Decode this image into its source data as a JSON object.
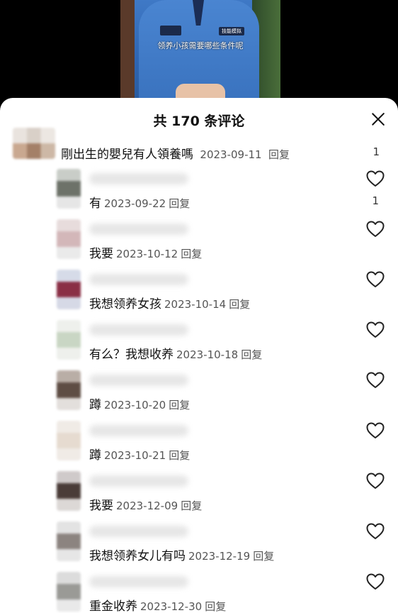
{
  "video": {
    "caption": "领养小孩需要哪些条件呢",
    "patch_text": "技能模拟"
  },
  "comments_panel": {
    "title": "共 170 条评论",
    "close_icon": "close-icon",
    "reply_label": "回复"
  },
  "parent_comment": {
    "text": "剛出生的嬰兒有人領養嗎",
    "date": "2023-09-11",
    "reply_label": "回复",
    "count": "1"
  },
  "replies": [
    {
      "text": "有",
      "date": "2023-09-22",
      "reply_label": "回复",
      "likes": "1"
    },
    {
      "text": "我要",
      "date": "2023-10-12",
      "reply_label": "回复",
      "likes": ""
    },
    {
      "text": "我想领养女孩",
      "date": "2023-10-14",
      "reply_label": "回复",
      "likes": ""
    },
    {
      "text": "有么？我想收养",
      "date": "2023-10-18",
      "reply_label": "回复",
      "likes": ""
    },
    {
      "text": "蹲",
      "date": "2023-10-20",
      "reply_label": "回复",
      "likes": ""
    },
    {
      "text": "蹲",
      "date": "2023-10-21",
      "reply_label": "回复",
      "likes": ""
    },
    {
      "text": "我要",
      "date": "2023-12-09",
      "reply_label": "回复",
      "likes": ""
    },
    {
      "text": "我想领养女儿有吗",
      "date": "2023-12-19",
      "reply_label": "回复",
      "likes": ""
    },
    {
      "text": "重金收养",
      "date": "2023-12-30",
      "reply_label": "回复",
      "likes": ""
    }
  ],
  "colors": {
    "sheet_bg": "#ffffff",
    "meta_text": "#555555",
    "primary_text": "#111111"
  }
}
